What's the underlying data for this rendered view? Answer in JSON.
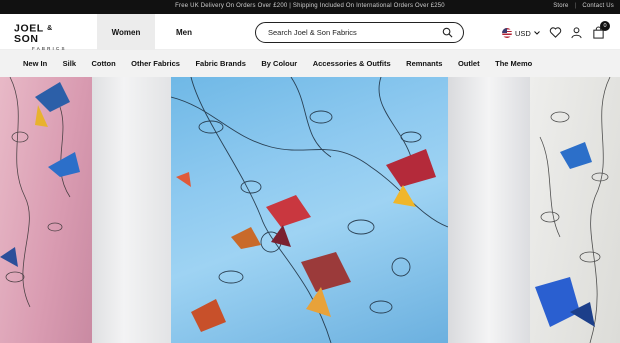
{
  "topbar": {
    "promo": "Free UK Delivery On Orders Over £200 | Shipping Included On International Orders Over £250",
    "links": [
      "Store",
      "Contact Us"
    ]
  },
  "header": {
    "logo_main": "JOEL",
    "logo_amp": "&",
    "logo_main2": "SON",
    "logo_sub": "FABRICS",
    "tabs": [
      "Women",
      "Men"
    ],
    "active_tab": "Women",
    "search_placeholder": "Search Joel & Son Fabrics",
    "currency": "USD",
    "cart_count": "0"
  },
  "nav": {
    "items": [
      "New In",
      "Silk",
      "Cotton",
      "Other Fabrics",
      "Fabric Brands",
      "By Colour",
      "Accessories & Outfits",
      "Remnants",
      "Outlet",
      "The Memo"
    ]
  },
  "colors": {
    "topbar_bg": "#111111",
    "nav_bg": "#f2f2f2",
    "active_tab_bg": "#ececec",
    "hero_blue": "#8fcaf0",
    "hero_pink": "#d99bb1"
  },
  "icons": [
    "search-icon",
    "chevron-down-icon",
    "heart-icon",
    "user-icon",
    "bag-icon"
  ]
}
